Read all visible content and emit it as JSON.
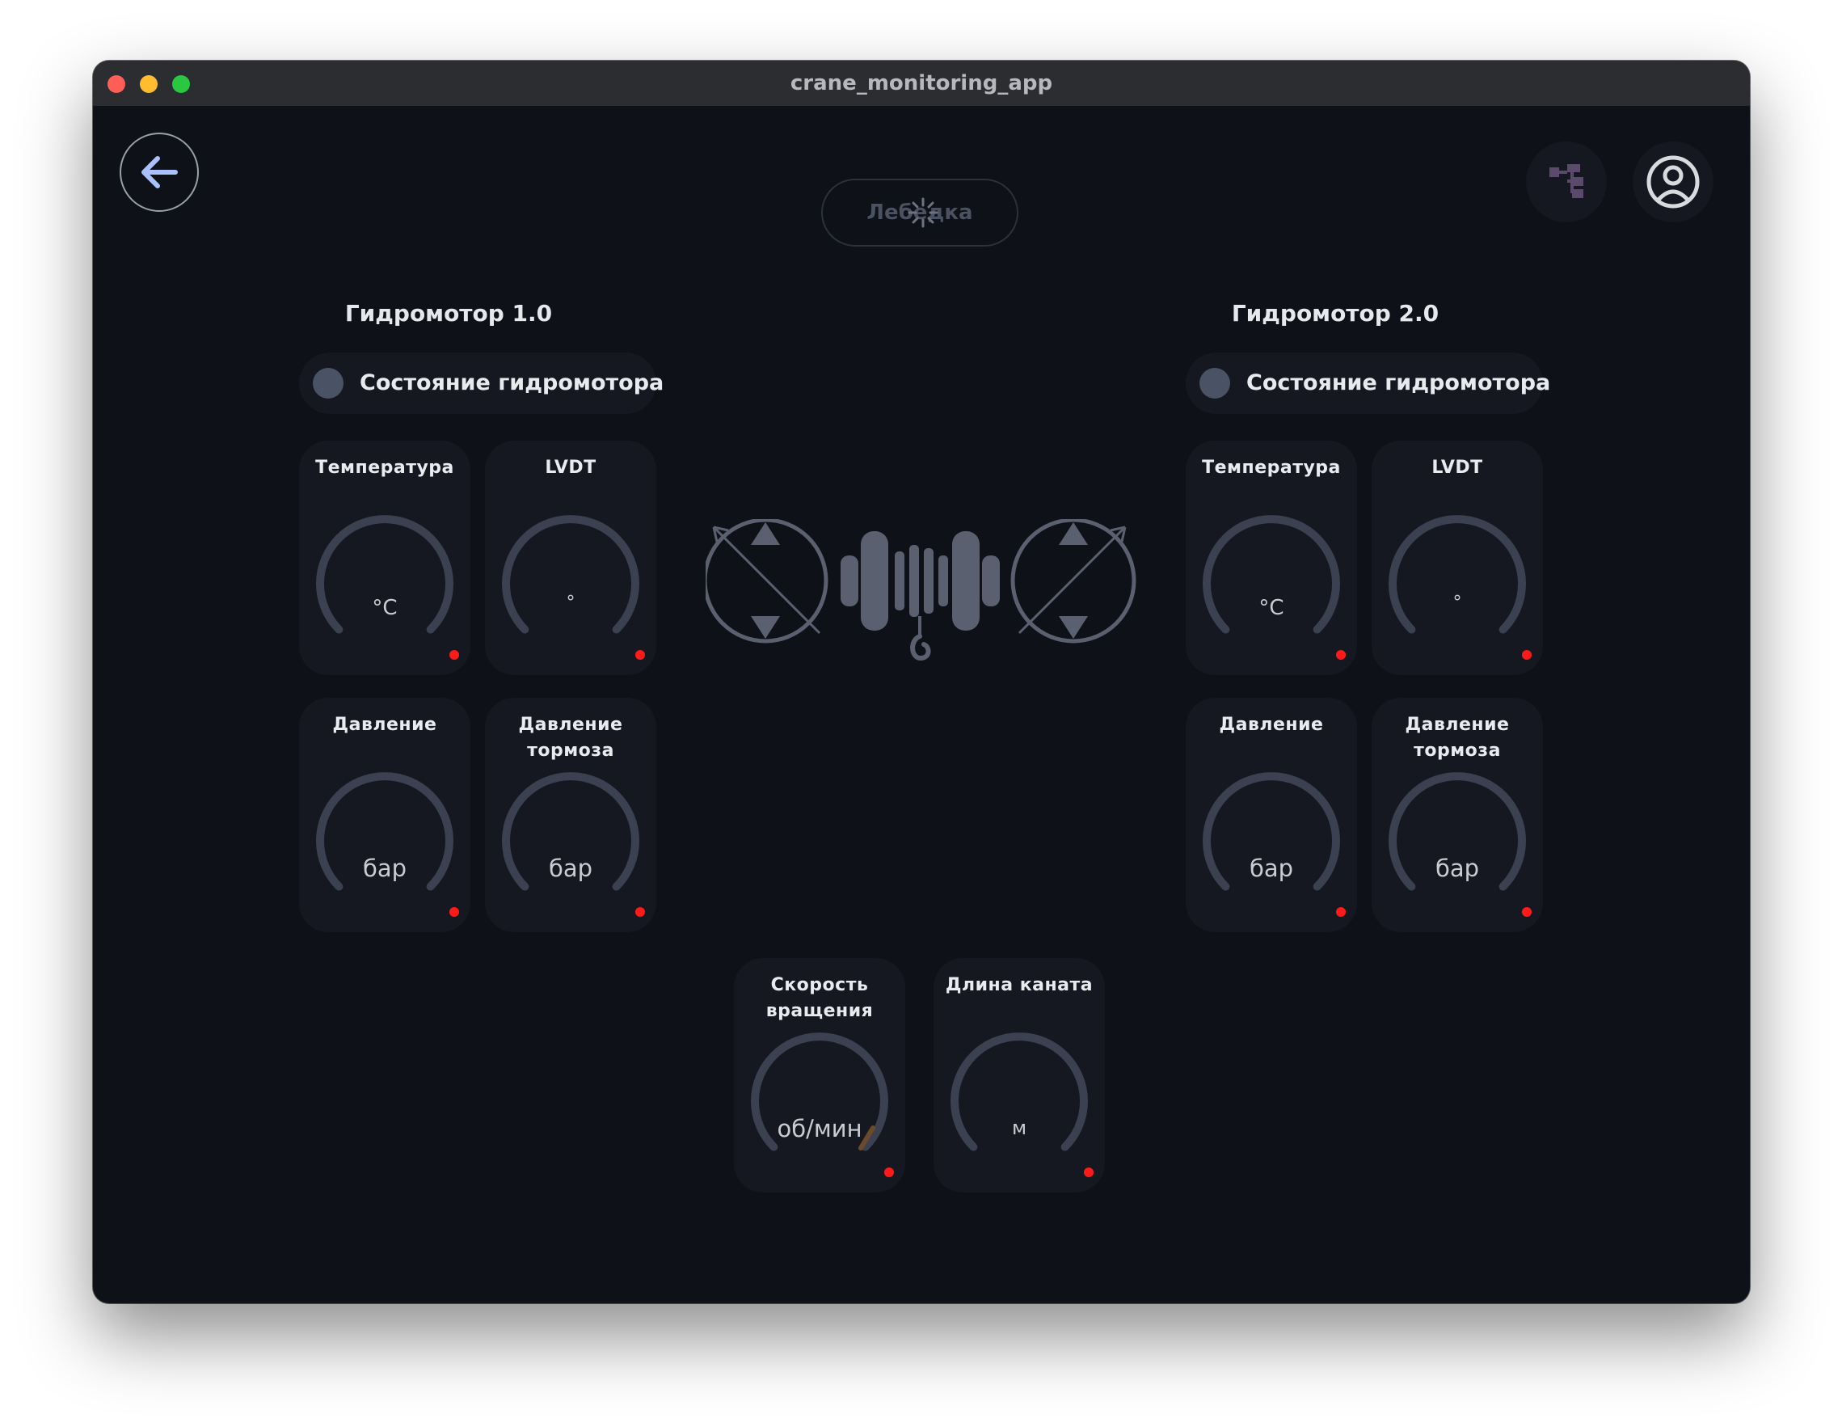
{
  "window": {
    "title": "crane_monitoring_app"
  },
  "header": {
    "tab_label": "Лебедка",
    "back_icon": "arrow-left-icon",
    "hierarchy_icon": "hierarchy-icon",
    "account_icon": "account-circle-icon"
  },
  "motors": [
    {
      "title": "Гидромотор 1.0",
      "status_label": "Состояние гидромотора",
      "status_color": "#4a5366",
      "gauges": [
        {
          "label": "Температура",
          "unit": "°C"
        },
        {
          "label": "LVDT",
          "unit": "°"
        },
        {
          "label": "Давление",
          "unit": "бар"
        },
        {
          "label": "Давление тормоза",
          "unit": "бар"
        }
      ]
    },
    {
      "title": "Гидромотор 2.0",
      "status_label": "Состояние гидромотора",
      "status_color": "#4a5366",
      "gauges": [
        {
          "label": "Температура",
          "unit": "°C"
        },
        {
          "label": "LVDT",
          "unit": "°"
        },
        {
          "label": "Давление",
          "unit": "бар"
        },
        {
          "label": "Давление тормоза",
          "unit": "бар"
        }
      ]
    }
  ],
  "bottom_gauges": [
    {
      "label": "Скорость вращения",
      "unit": "об/мин"
    },
    {
      "label": "Длина каната",
      "unit": "м"
    }
  ],
  "colors": {
    "alarm_led": "#ff1a1a",
    "gauge_track": "#3b4150",
    "rpm_needle": "#6b4a2a"
  }
}
